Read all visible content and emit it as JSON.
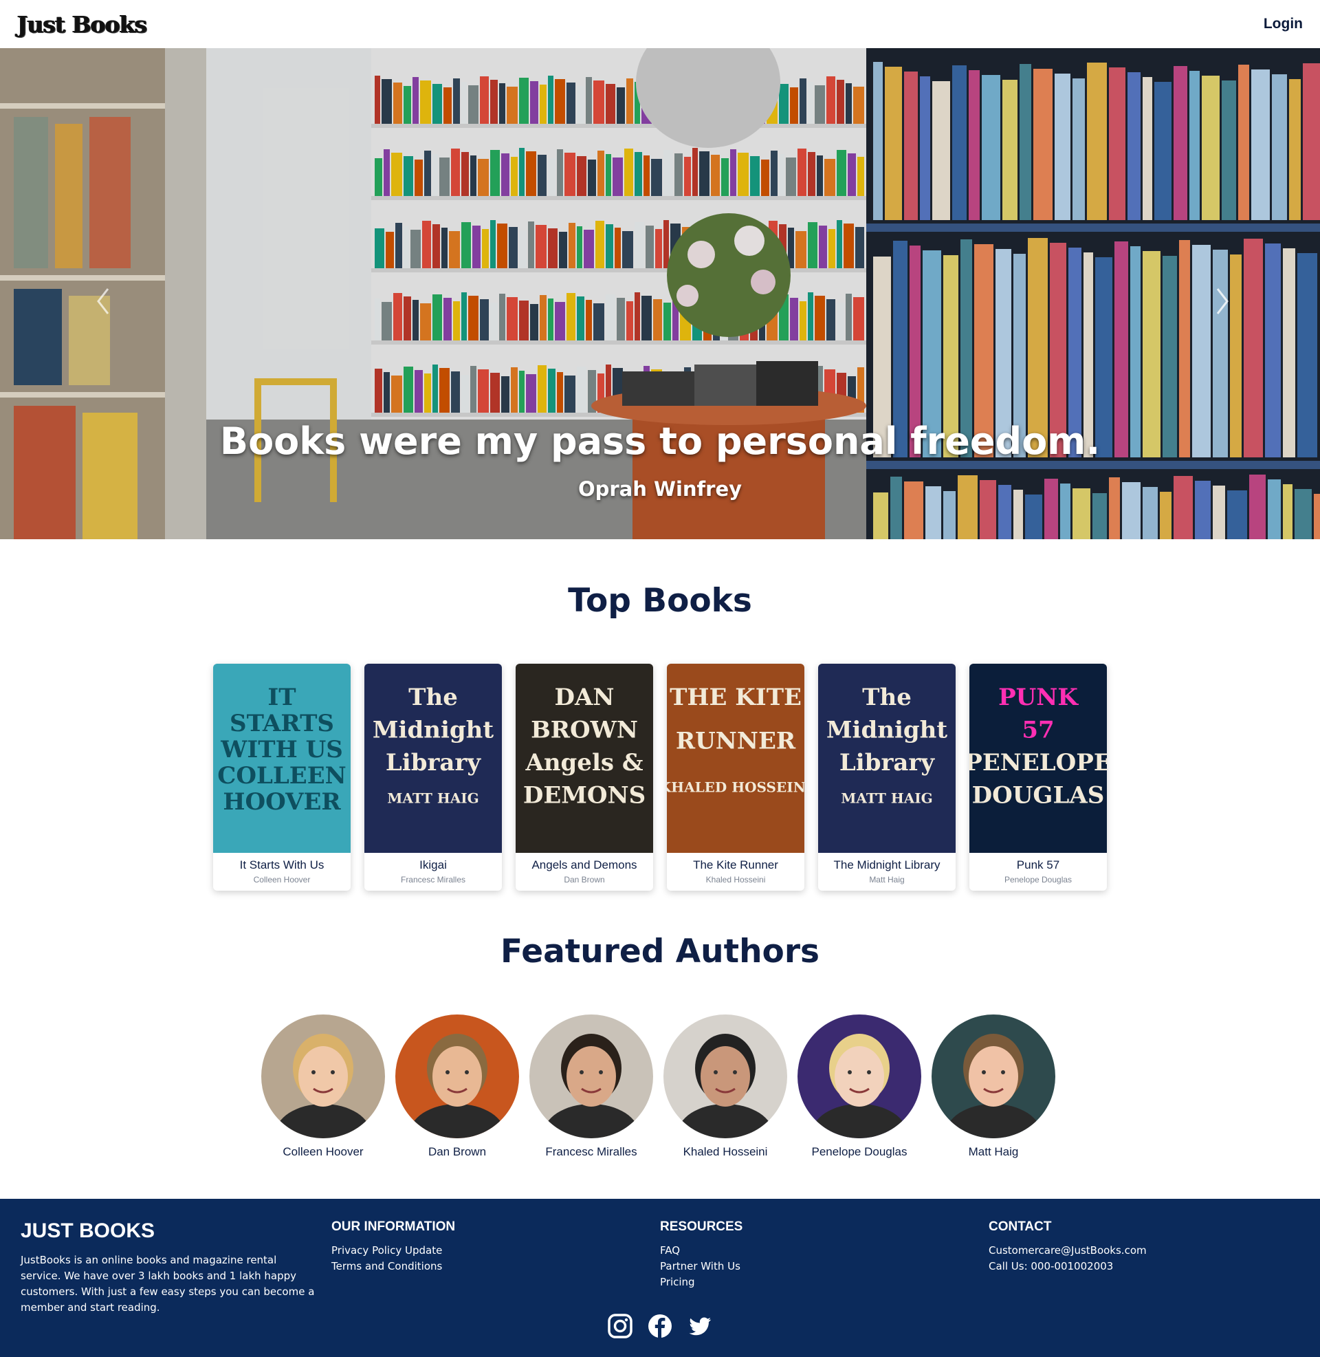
{
  "header": {
    "logo": "Just Books",
    "login_label": "Login"
  },
  "hero": {
    "quote": "Books were my pass to personal freedom.",
    "author": "Oprah Winfrey"
  },
  "top_books": {
    "title": "Top Books",
    "items": [
      {
        "title": "It Starts With Us",
        "author": "Colleen Hoover",
        "cover_lines": [
          "IT",
          "STARTS",
          "WITH US",
          "COLLEEN",
          "HOOVER"
        ],
        "cover_color": "#3aa7b8"
      },
      {
        "title": "Ikigai",
        "author": "Francesc Miralles",
        "cover_lines": [
          "The",
          "Midnight",
          "Library",
          "MATT HAIG"
        ],
        "cover_color": "#1f2a55"
      },
      {
        "title": "Angels and Demons",
        "author": "Dan Brown",
        "cover_lines": [
          "DAN",
          "BROWN",
          "Angels &",
          "DEMONS"
        ],
        "cover_color": "#2a2620"
      },
      {
        "title": "The Kite Runner",
        "author": "Khaled Hosseini",
        "cover_lines": [
          "THE KITE",
          "RUNNER",
          "KHALED HOSSEINI"
        ],
        "cover_color": "#9a4a1c"
      },
      {
        "title": "The Midnight Library",
        "author": "Matt Haig",
        "cover_lines": [
          "The",
          "Midnight",
          "Library",
          "MATT HAIG"
        ],
        "cover_color": "#1f2a55"
      },
      {
        "title": "Punk 57",
        "author": "Penelope Douglas",
        "cover_lines": [
          "PUNK",
          "57",
          "PENELOPE",
          "DOUGLAS"
        ],
        "cover_color": "#0b1e3a"
      }
    ]
  },
  "featured_authors": {
    "title": "Featured Authors",
    "items": [
      {
        "name": "Colleen Hoover",
        "bg": "#b7a690",
        "hair": "#d9b16a",
        "skin": "#f0c8a8"
      },
      {
        "name": "Dan Brown",
        "bg": "#c8561e",
        "hair": "#8a6a40",
        "skin": "#e8b894"
      },
      {
        "name": "Francesc Miralles",
        "bg": "#c9c2b8",
        "hair": "#2a211a",
        "skin": "#d9a888"
      },
      {
        "name": "Khaled Hosseini",
        "bg": "#d6d2cc",
        "hair": "#222222",
        "skin": "#c9977a"
      },
      {
        "name": "Penelope Douglas",
        "bg": "#3b2a70",
        "hair": "#e8d08a",
        "skin": "#f2d2bc"
      },
      {
        "name": "Matt Haig",
        "bg": "#2e4a4d",
        "hair": "#7a5a3a",
        "skin": "#f0c2a6"
      }
    ]
  },
  "footer": {
    "brand": "JUST BOOKS",
    "about": "JustBooks is an online books and magazine rental service. We have over 3 lakh books and 1 lakh happy customers. With just a few easy steps you can become a member and start reading.",
    "info_heading": "OUR INFORMATION",
    "info_links": [
      "Privacy Policy Update",
      "Terms and Conditions"
    ],
    "resources_heading": "RESOURCES",
    "resources_links": [
      "FAQ",
      "Partner With Us",
      "Pricing"
    ],
    "contact_heading": "CONTACT",
    "contact_email": "Customercare@JustBooks.com",
    "contact_phone": "Call Us: 000-001002003",
    "social_icons": [
      "instagram-icon",
      "facebook-icon",
      "twitter-icon"
    ]
  },
  "colors": {
    "navy": "#0f1f45",
    "footer_bg": "#0b2a5b"
  }
}
